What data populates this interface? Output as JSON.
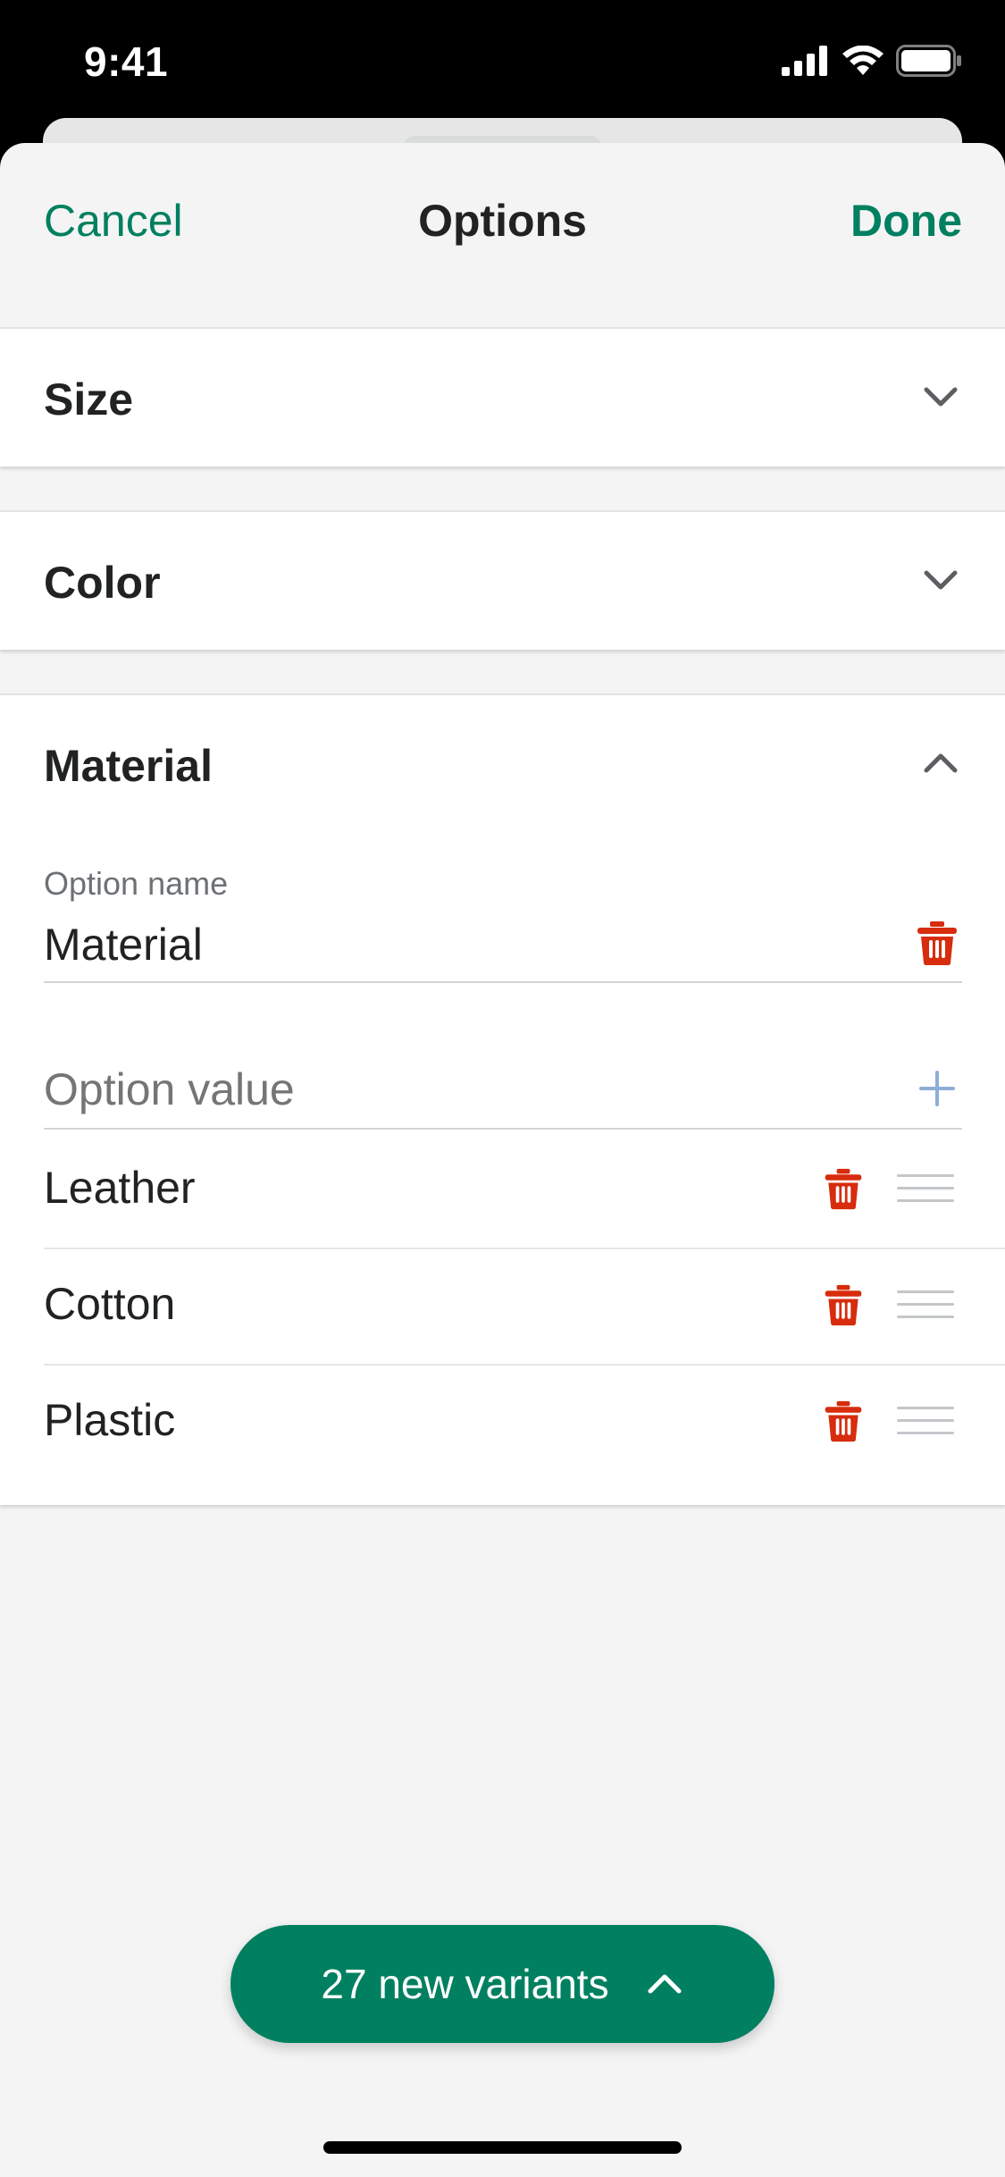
{
  "status_bar": {
    "time": "9:41"
  },
  "nav": {
    "cancel_label": "Cancel",
    "title": "Options",
    "done_label": "Done"
  },
  "sections": [
    {
      "title": "Size",
      "expanded": false
    },
    {
      "title": "Color",
      "expanded": false
    },
    {
      "title": "Material",
      "expanded": true,
      "option_name_label": "Option name",
      "option_name_value": "Material",
      "option_value_placeholder": "Option value",
      "values": [
        "Leather",
        "Cotton",
        "Plastic"
      ]
    }
  ],
  "footer": {
    "variants_label": "27 new variants"
  },
  "colors": {
    "accent": "#008060",
    "destructive": "#d72c0d",
    "add": "#8eadd6",
    "background": "#f4f4f4"
  }
}
